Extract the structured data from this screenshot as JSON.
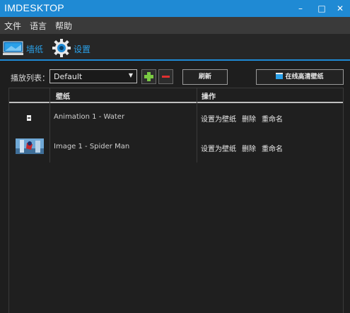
{
  "window": {
    "title": "IMDESKTOP",
    "minimize_label": "–",
    "maximize_label": "□",
    "close_label": "✕"
  },
  "menu": {
    "items": [
      {
        "label": "文件"
      },
      {
        "label": "语言"
      },
      {
        "label": "帮助"
      }
    ]
  },
  "tabs": [
    {
      "label": "墙纸",
      "icon": "monitor-icon",
      "active": true
    },
    {
      "label": "设置",
      "icon": "gear-icon",
      "active": false
    }
  ],
  "toolbar": {
    "playlist_label": "播放列表：",
    "playlist_value": "Default",
    "add_icon": "plus-icon",
    "remove_icon": "minus-icon",
    "refresh_label": "刷新",
    "online_label": "在线高清壁纸",
    "online_icon": "film-icon"
  },
  "table": {
    "columns": [
      "壁纸",
      "操作"
    ],
    "rows": [
      {
        "name": "Animation 1 - Water",
        "thumb": "file-icon",
        "actions": [
          "设置为壁纸",
          "删除",
          "重命名"
        ]
      },
      {
        "name": "Image 1 - Spider Man",
        "thumb": "image-thumbnail",
        "actions": [
          "设置为壁纸",
          "删除",
          "重命名"
        ]
      }
    ]
  },
  "colors": {
    "accent": "#1f8ad4",
    "tab_text": "#2aa0e8",
    "add_green": "#7ac943",
    "remove_red": "#e03030"
  }
}
